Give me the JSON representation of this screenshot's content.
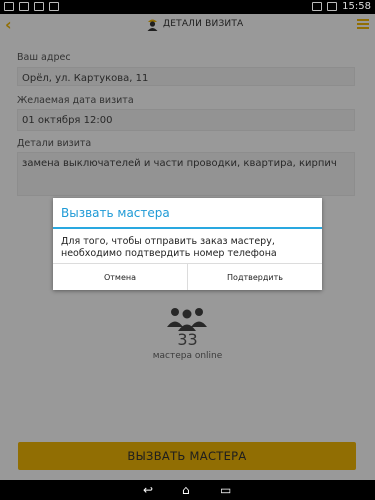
{
  "status_bar": {
    "time": "15:58",
    "icons": [
      "usb-icon",
      "image-icon",
      "mail-icon",
      "android-icon",
      "wifi-icon",
      "battery-icon"
    ]
  },
  "app_bar": {
    "title": "ДЕТАЛИ ВИЗИТА",
    "accent_color": "#f2b705"
  },
  "form": {
    "address_label": "Ваш адрес",
    "address_value": "Орёл, ул. Картукова, 11",
    "date_label": "Желаемая дата визита",
    "date_value": "01 октября 12:00",
    "details_label": "Детали визита",
    "details_value": "замена выключателей и части проводки, квартира, кирпич"
  },
  "masters": {
    "count": "33",
    "online_label": "мастера online"
  },
  "call_button": {
    "label": "ВЫЗВАТЬ МАСТЕРА"
  },
  "dialog": {
    "title": "Вызвать мастера",
    "message": "Для того, чтобы отправить заказ мастеру, необходимо подтвердить номер телефона",
    "cancel_label": "Отмена",
    "confirm_label": "Подтвердить",
    "title_color": "#1e9ad6"
  }
}
